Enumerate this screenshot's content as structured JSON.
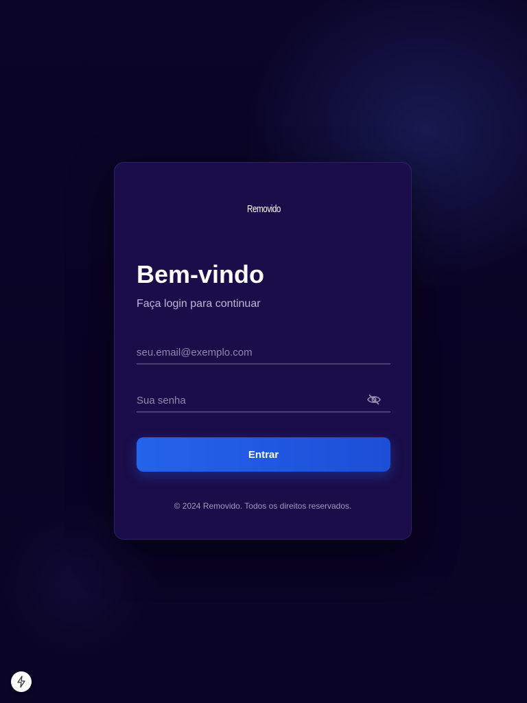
{
  "brand": {
    "logo_text": "Removido",
    "logo_icon": "removido-logo-icon"
  },
  "login": {
    "title": "Bem-vindo",
    "subtitle": "Faça login para continuar",
    "email": {
      "placeholder": "seu.email@exemplo.com",
      "value": ""
    },
    "password": {
      "placeholder": "Sua senha",
      "value": "",
      "toggle_icon": "eye-off-icon"
    },
    "submit_label": "Entrar",
    "footer": "© 2024 Removido. Todos os direitos reservados."
  },
  "dev_badge": {
    "icon": "lightning-bolt-icon"
  },
  "colors": {
    "background": "#0a0426",
    "card": "#1b0d4a",
    "accent": "#2563eb",
    "text_primary": "#ffffff",
    "text_secondary": "#bdb7d8"
  }
}
